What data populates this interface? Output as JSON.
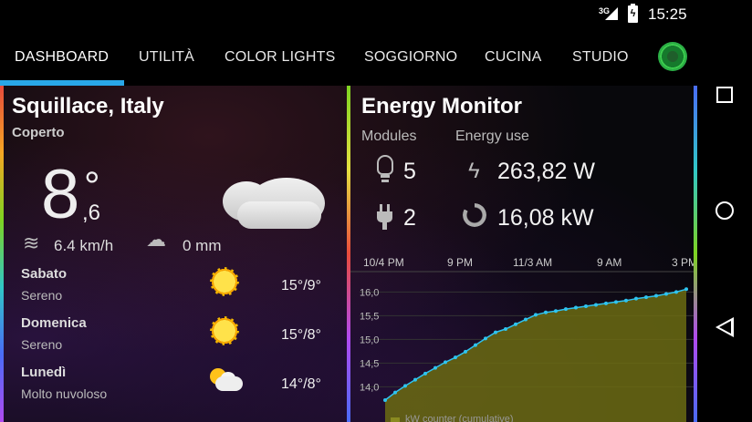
{
  "status_bar": {
    "network": "3G",
    "battery_icon": "battery-charging-icon",
    "time": "15:25"
  },
  "tabs": [
    {
      "label": "DASHBOARD",
      "active": true
    },
    {
      "label": "UTILITÀ",
      "active": false
    },
    {
      "label": "COLOR LIGHTS",
      "active": false
    },
    {
      "label": "SOGGIORNO",
      "active": false
    },
    {
      "label": "CUCINA",
      "active": false
    },
    {
      "label": "STUDIO",
      "active": false
    }
  ],
  "connection_indicator": {
    "icon": "status-indicator-icon",
    "color": "#2bb046"
  },
  "accent_color": "#29a7e8",
  "weather": {
    "city": "Squillace, Italy",
    "condition": "Coperto",
    "temp_int": "8",
    "temp_degree": "°",
    "temp_dec": ",6",
    "icon": "cloud-icon",
    "wind": "6.4 km/h",
    "wind_icon": "wind-icon",
    "rain": "0 mm",
    "rain_icon": "rain-icon",
    "forecast": [
      {
        "day": "Sabato",
        "condition": "Sereno",
        "temps": "15°/9°",
        "icon": "sun-icon"
      },
      {
        "day": "Domenica",
        "condition": "Sereno",
        "temps": "15°/8°",
        "icon": "sun-icon"
      },
      {
        "day": "Lunedì",
        "condition": "Molto nuvoloso",
        "temps": "14°/8°",
        "icon": "partly-cloudy-icon"
      }
    ]
  },
  "energy": {
    "title": "Energy Monitor",
    "modules_header": "Modules",
    "energy_header": "Energy use",
    "modules_on": "5",
    "modules_plugged": "2",
    "power": "263,82 W",
    "total": "16,08 kW",
    "legend_partial": "kW counter (cumulative)"
  },
  "chart_data": {
    "type": "area",
    "x_ticks": [
      "10/4 PM",
      "9 PM",
      "11/3 AM",
      "9 AM",
      "3 PM"
    ],
    "y_ticks": [
      "14,0",
      "14,5",
      "15,0",
      "15,5",
      "16,0"
    ],
    "ylim": [
      13.7,
      16.2
    ],
    "series": [
      {
        "color": "#6b6b12",
        "line_color": "#2ec4f0",
        "values": [
          13.72,
          13.88,
          14.02,
          14.15,
          14.28,
          14.4,
          14.52,
          14.62,
          14.74,
          14.88,
          15.02,
          15.15,
          15.22,
          15.32,
          15.42,
          15.52,
          15.57,
          15.6,
          15.64,
          15.67,
          15.7,
          15.73,
          15.76,
          15.79,
          15.82,
          15.86,
          15.89,
          15.92,
          15.96,
          16.0,
          16.06
        ]
      }
    ]
  }
}
